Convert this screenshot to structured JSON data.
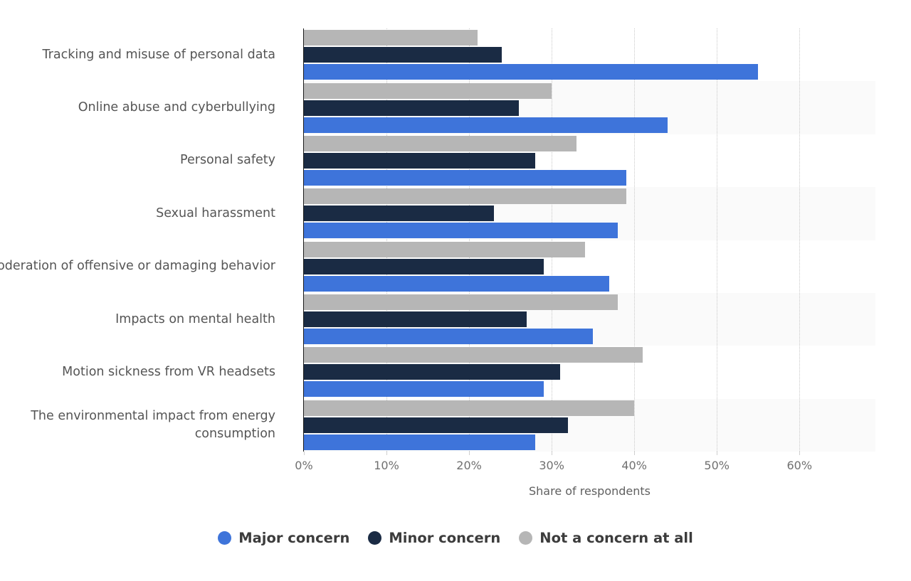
{
  "chart_data": {
    "type": "bar",
    "orientation": "horizontal",
    "title": "",
    "xlabel": "Share of respondents",
    "ylabel": "",
    "xlim": [
      0,
      69.2
    ],
    "xticks": [
      "0%",
      "10%",
      "20%",
      "30%",
      "40%",
      "50%",
      "60%"
    ],
    "xtick_values": [
      0,
      10,
      20,
      30,
      40,
      50,
      60
    ],
    "grid": "vertical-dotted",
    "legend_position": "bottom-center",
    "categories": [
      "Tracking and misuse of personal data",
      "Online abuse and cyberbullying",
      "Personal safety",
      "Sexual harassment",
      "Moderation of offensive or damaging behavior",
      "Impacts on mental health",
      "Motion sickness from VR headsets",
      "The environmental impact from energy consumption"
    ],
    "series": [
      {
        "name": "Major concern",
        "color": "#3e74da",
        "values": [
          55,
          44,
          39,
          38,
          37,
          35,
          29,
          28
        ]
      },
      {
        "name": "Minor concern",
        "color": "#1a2b44",
        "values": [
          24,
          26,
          28,
          23,
          29,
          27,
          31,
          32
        ]
      },
      {
        "name": "Not a concern at all",
        "color": "#b6b6b6",
        "values": [
          21,
          30,
          33,
          39,
          34,
          38,
          41,
          40
        ]
      }
    ]
  },
  "legend": {
    "items": [
      {
        "label": "Major concern",
        "color": "#3e74da"
      },
      {
        "label": "Minor concern",
        "color": "#1a2b44"
      },
      {
        "label": "Not a concern at all",
        "color": "#b6b6b6"
      }
    ]
  },
  "axis": {
    "x_title": "Share of respondents"
  }
}
